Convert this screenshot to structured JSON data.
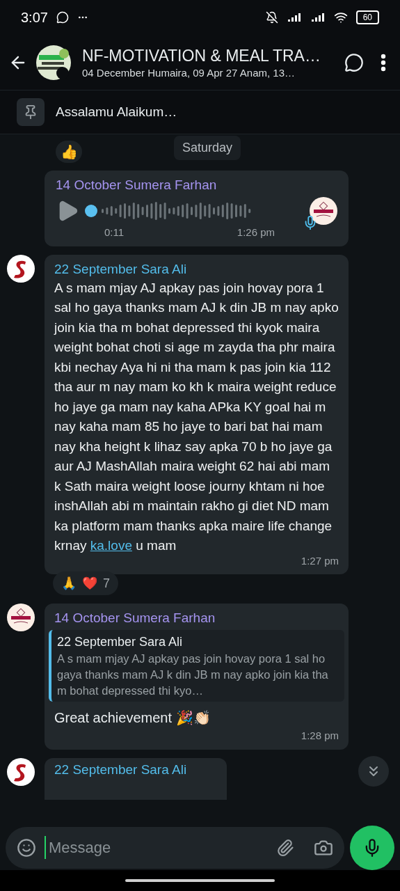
{
  "status_bar": {
    "time": "3:07",
    "battery": "60"
  },
  "header": {
    "title": "NF-MOTIVATION & MEAL TRA…",
    "subtitle": "04 December Humaira, 09 Apr 27 Anam, 13…"
  },
  "pinned": {
    "text": "Assalamu Alaikum…"
  },
  "top_reaction": "👍",
  "date_chip": "Saturday",
  "messages": [
    {
      "kind": "voice",
      "sender": "14 October Sumera Farhan",
      "color": "#a594f0",
      "duration": "0:11",
      "time": "1:26 pm"
    },
    {
      "kind": "text",
      "sender": "22 September Sara Ali",
      "color": "#53bdeb",
      "body_before": "A s mam mjay AJ apkay pas join hovay pora 1 sal ho gaya thanks mam AJ k din JB m nay apko join kia tha m bohat depressed thi kyok maira weight bohat choti si age m zayda tha phr maira kbi nechay Aya hi ni tha mam k pas join kia 112 tha aur m nay mam ko kh k maira weight reduce ho jaye ga mam nay kaha APka KY goal hai m nay kaha mam 85 ho jaye to bari bat hai mam nay kha height k lihaz say apka 70 b ho jaye ga aur AJ MashAllah maira weight 62 hai abi mam k Sath maira weight loose journy khtam ni hoe inshAllah abi m maintain rakho gi diet ND mam ka platform mam thanks apka maire life change krnay",
      "link": "ka.love",
      "body_after": "u mam",
      "time": "1:27 pm",
      "reactions": [
        "🙏",
        "❤️"
      ],
      "reaction_count": "7"
    },
    {
      "kind": "reply",
      "sender": "14 October Sumera Farhan",
      "color": "#a594f0",
      "quote": {
        "sender": "22 September Sara Ali",
        "text": "A s mam mjay AJ apkay pas join hovay pora 1 sal ho gaya thanks mam AJ k din JB m nay apko join kia tha m bohat depressed thi kyo…"
      },
      "body": "Great achievement 🎉👏🏻",
      "time": "1:28 pm"
    },
    {
      "kind": "cut",
      "sender": "22 September Sara Ali",
      "color": "#53bdeb"
    }
  ],
  "composer": {
    "placeholder": "Message"
  }
}
